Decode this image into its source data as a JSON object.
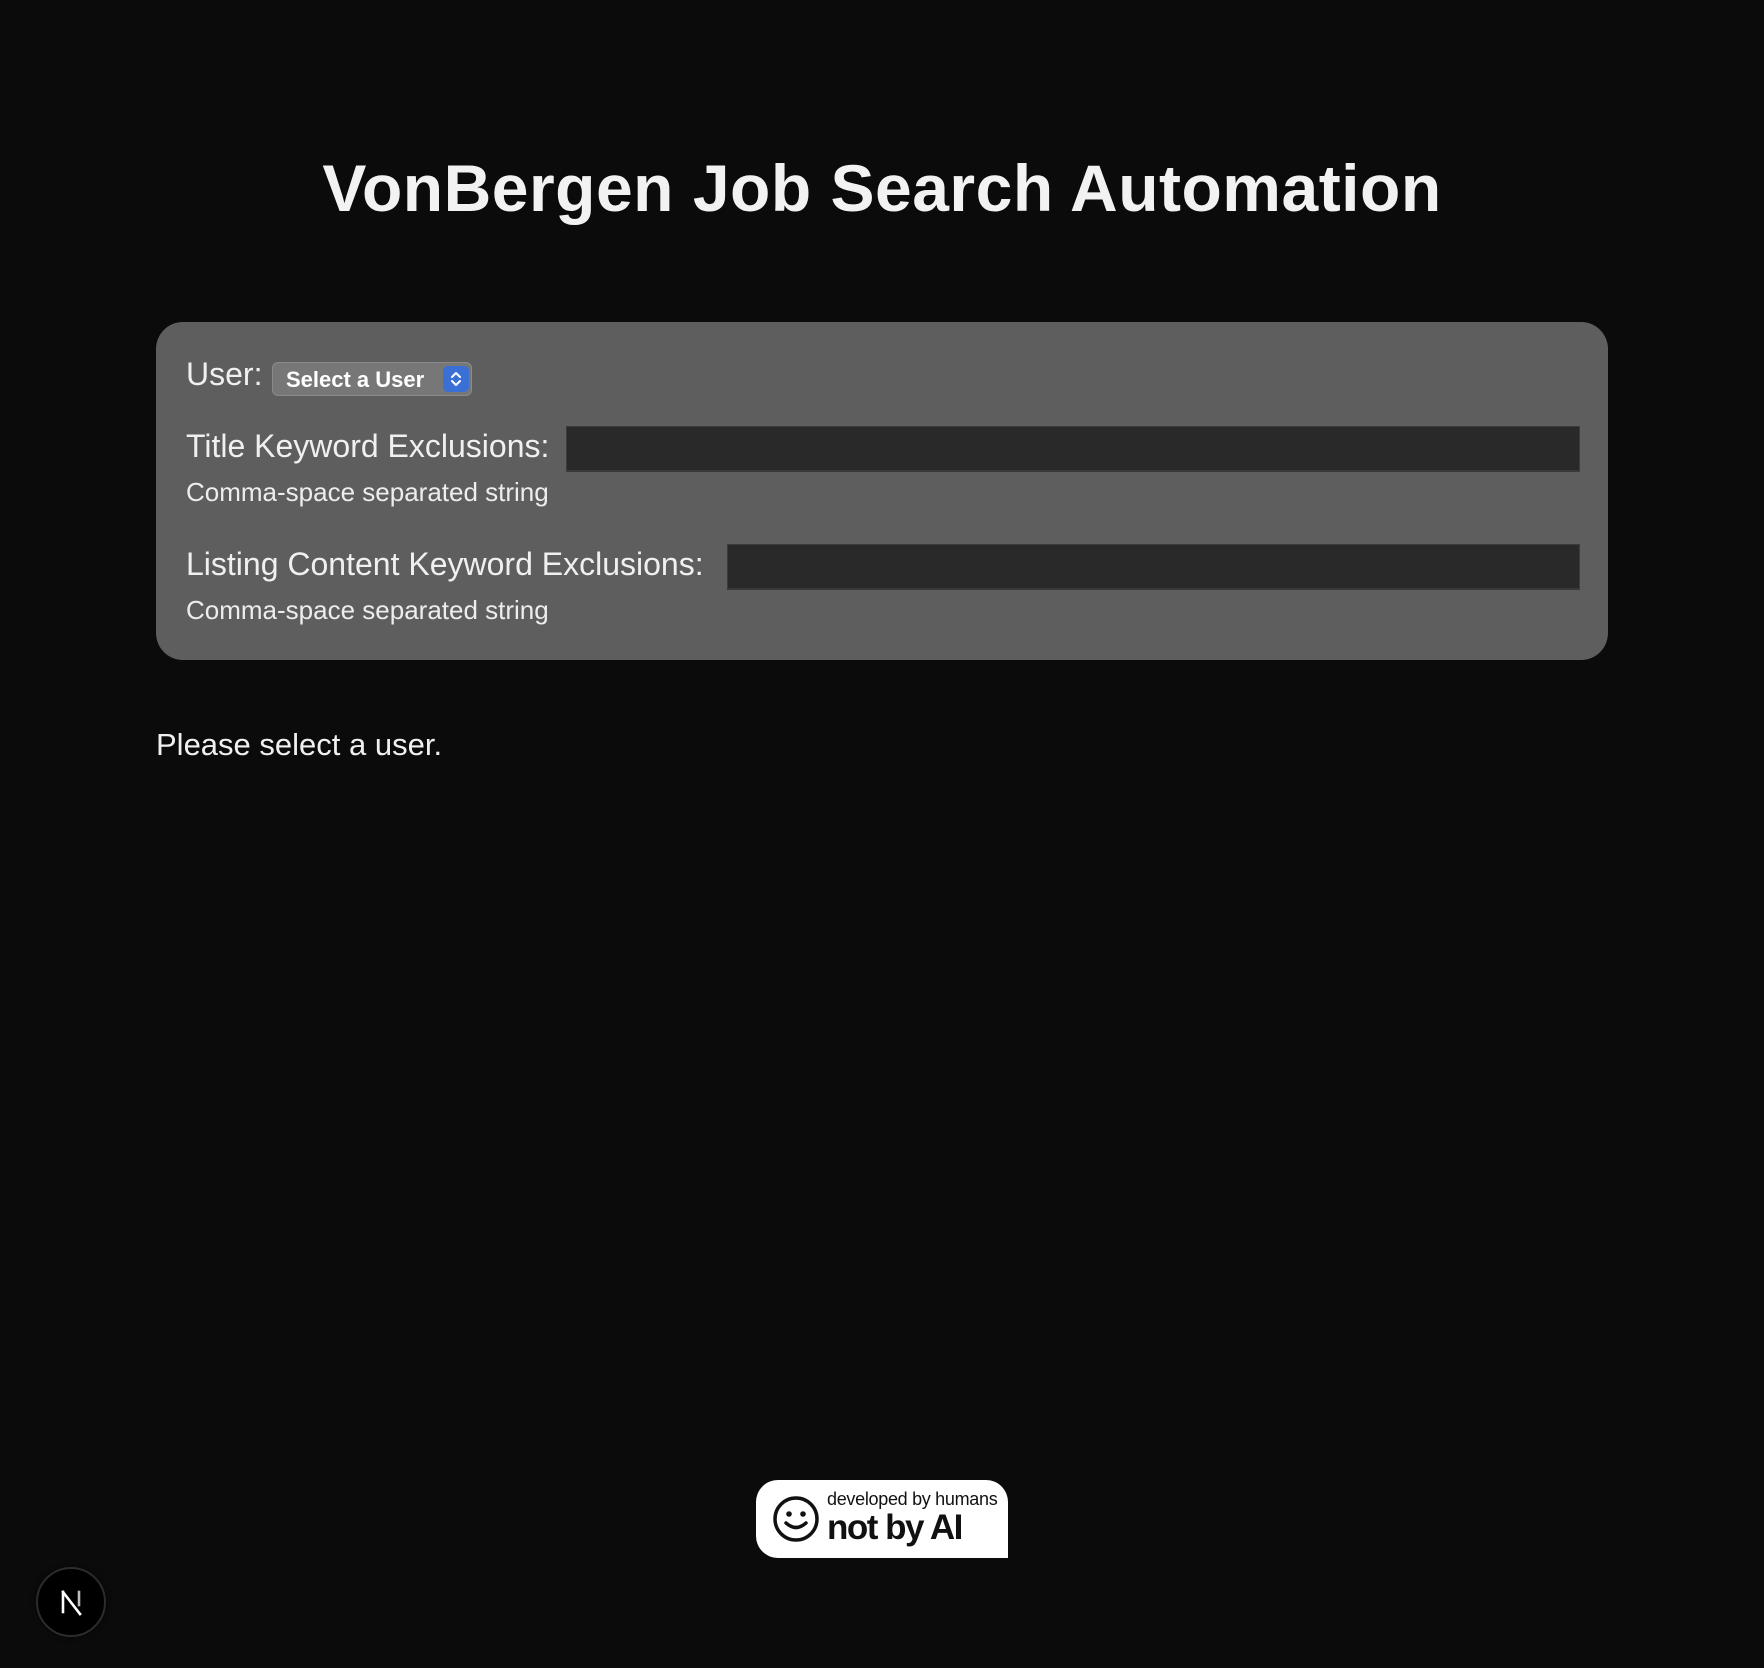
{
  "page": {
    "title": "VonBergen Job Search Automation"
  },
  "settings": {
    "user_label": "User:",
    "user_select": {
      "selected": "Select a User"
    },
    "title_exclusions": {
      "label": "Title Keyword Exclusions:",
      "value": "",
      "hint": "Comma-space separated string"
    },
    "content_exclusions": {
      "label": "Listing Content Keyword Exclusions:",
      "value": "",
      "hint": "Comma-space separated string"
    }
  },
  "status": {
    "message": "Please select a user."
  },
  "badge": {
    "small_text": "developed by humans",
    "big_text": "not by AI",
    "icon": "smiley-face-icon"
  },
  "dev_indicator": {
    "icon": "nextjs-logo-icon",
    "letter": "N"
  },
  "colors": {
    "background": "#0b0b0b",
    "panel": "#5e5e5e",
    "input_background": "#292929",
    "select_accent": "#3a6fd6",
    "text": "#ededed"
  }
}
